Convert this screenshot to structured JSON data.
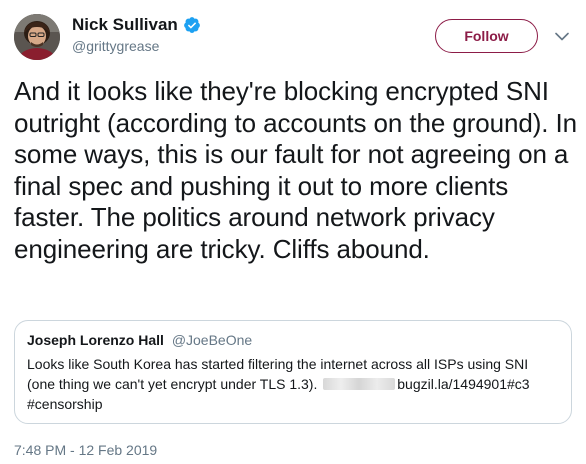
{
  "author": {
    "name": "Nick Sullivan",
    "handle": "@grittygrease",
    "verified": true,
    "avatar_icon": "profile-photo"
  },
  "actions": {
    "follow_label": "Follow",
    "more_icon": "chevron-down-icon"
  },
  "tweet": {
    "text": "And it looks like they're blocking encrypted SNI outright (according to accounts on the ground). In some ways, this is our fault for not agreeing on a final spec and pushing it out to more clients faster. The politics around network privacy engineering are tricky. Cliffs abound.",
    "timestamp": "7:48 PM - 12 Feb 2019"
  },
  "quoted_tweet": {
    "author_name": "Joseph Lorenzo Hall",
    "author_handle": "@JoeBeOne",
    "text_before_redaction": "Looks like South Korea has started filtering the internet across all ISPs using SNI (one thing we can't yet encrypt under TLS 1.3).",
    "link_text": "bugzil.la/1494901#c3",
    "hashtag": "#censorship"
  },
  "colors": {
    "follow_accent": "#8c1c47",
    "verified_blue": "#1da1f2",
    "secondary_text": "#657786",
    "primary_text": "#14171a",
    "border": "#ccd6dd"
  }
}
